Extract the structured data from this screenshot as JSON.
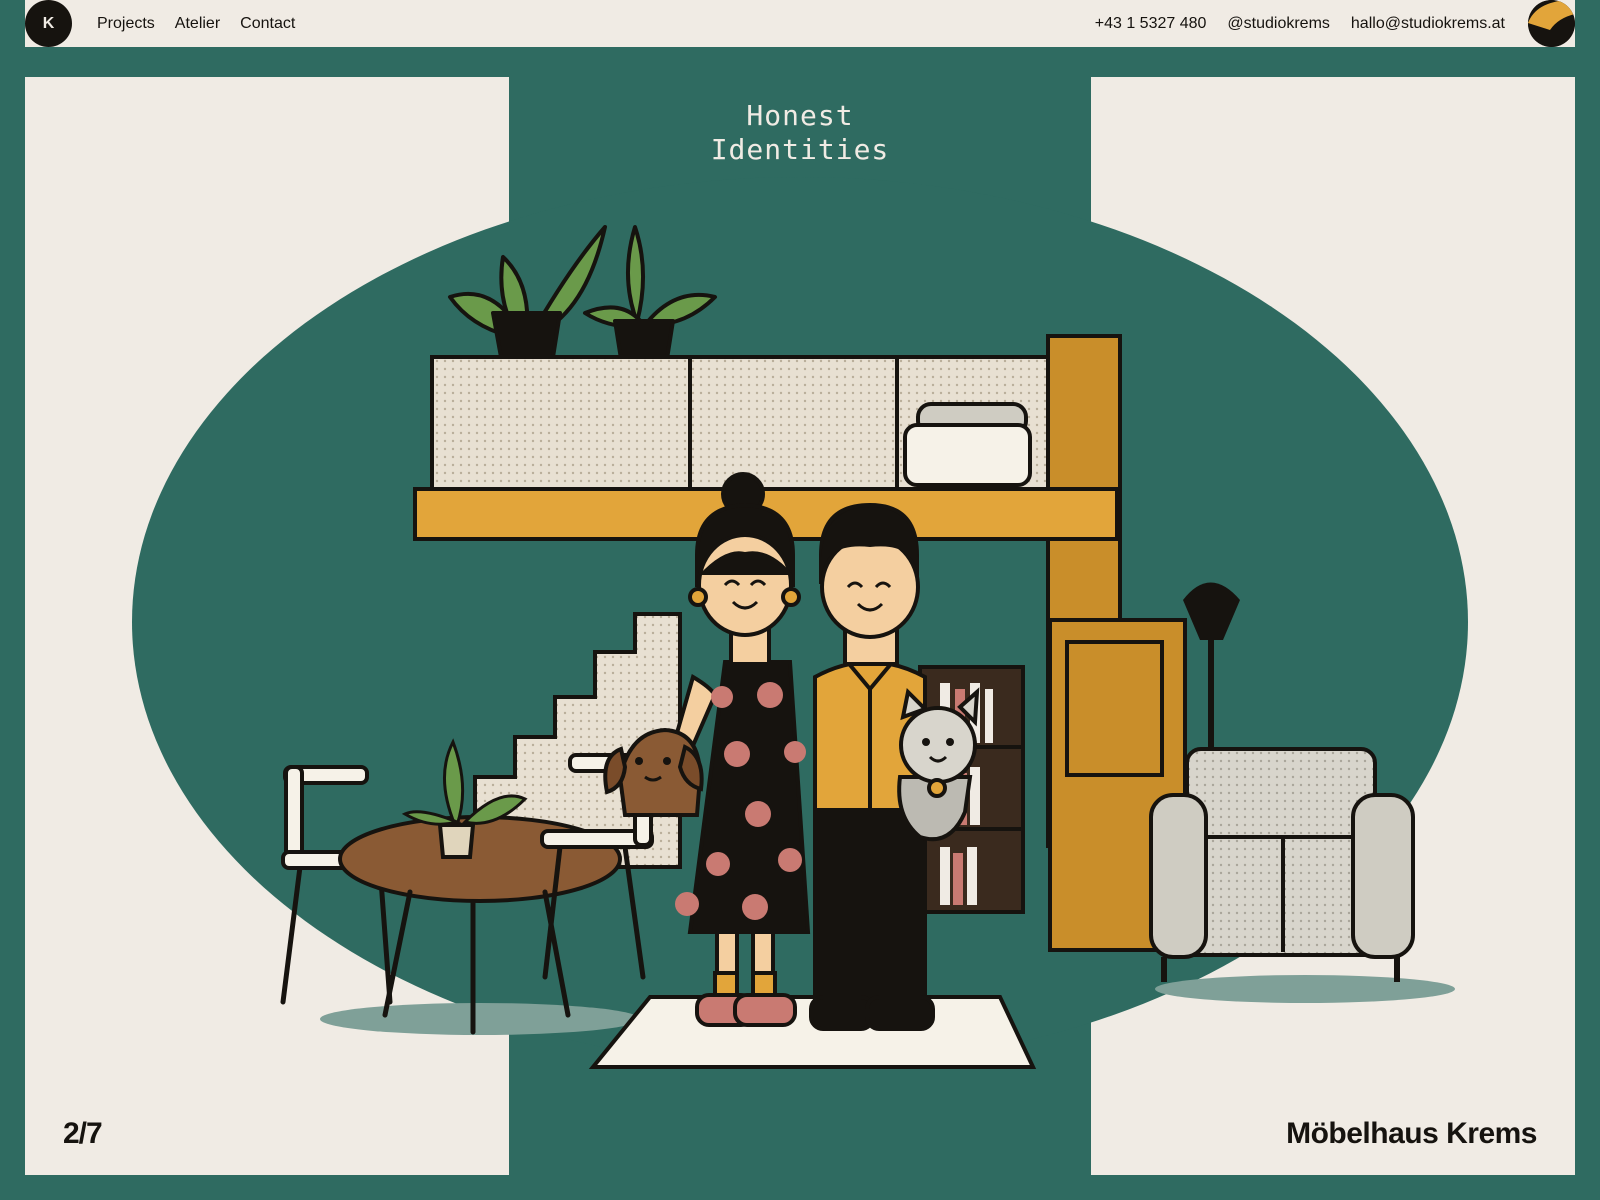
{
  "nav": {
    "logo_letter": "K",
    "links": [
      "Projects",
      "Atelier",
      "Contact"
    ],
    "phone": "+43 1 5327 480",
    "social": "@studiokrems",
    "email": "hallo@studiokrems.at"
  },
  "hero": {
    "tagline": "Honest\nIdentities",
    "counter": "2/7",
    "project_title": "Möbelhaus Krems",
    "illustration": "illustration of a couple with a dog and a cat standing on a rug in a furnished living room"
  },
  "colors": {
    "teal": "#2f6b61",
    "cream": "#f0ebe4",
    "ink": "#16130f",
    "mustard": "#e2a53a",
    "ochre": "#c98e2a",
    "pink": "#c97a72",
    "leaf": "#6a9a4a",
    "grey": "#cfccc2",
    "brown": "#8a5a34"
  },
  "icons": [
    "theme-toggle-icon"
  ]
}
